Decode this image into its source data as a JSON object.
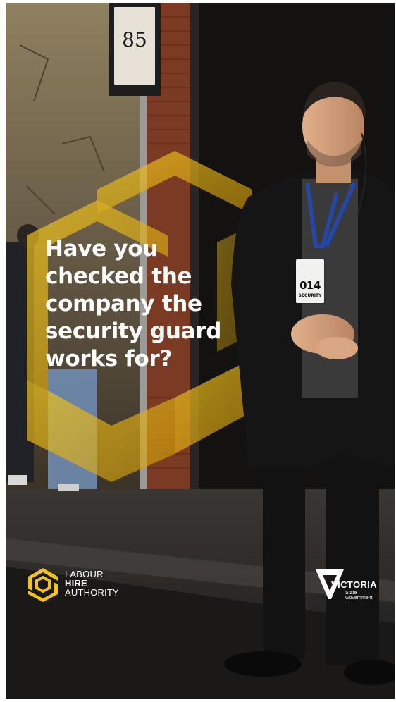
{
  "poster": {
    "address_number": "85",
    "headline_lines": [
      "Have you",
      "checked the",
      "company the",
      "security guard",
      "works for?"
    ],
    "badge": {
      "number": "014",
      "label": "SECURITY"
    }
  },
  "logos": {
    "labour_hire_authority": {
      "line1": "LABOUR",
      "line2": "HIRE",
      "line3": "AUTHORITY",
      "icon": "hexagon-logo-icon"
    },
    "victoria_government": {
      "name": "VICTORIA",
      "sub_line1": "State",
      "sub_line2": "Government",
      "icon": "victoria-map-icon"
    }
  },
  "colors": {
    "accent_yellow": "#f2c21b",
    "text_white": "#ffffff",
    "coat_black": "#151515",
    "lanyard_blue": "#2447a8"
  }
}
